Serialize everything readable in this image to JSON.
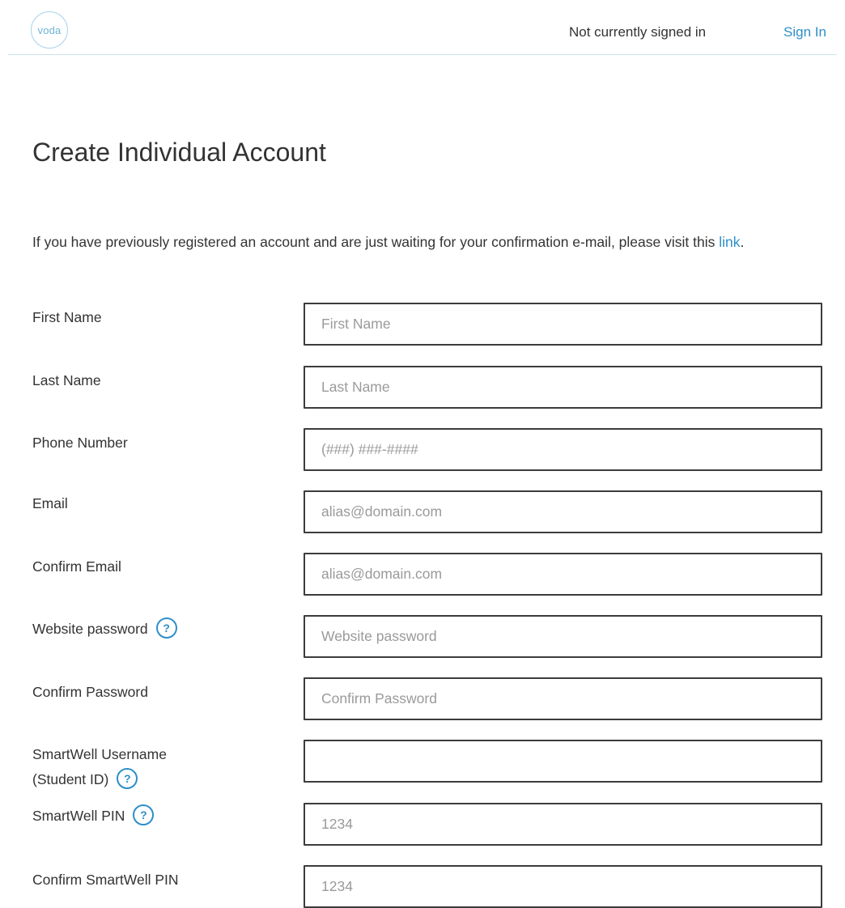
{
  "header": {
    "logo_text": "voda",
    "status_text": "Not currently signed in",
    "signin_label": "Sign In"
  },
  "page": {
    "title": "Create Individual Account",
    "intro_text": "If you have previously registered an account and are just waiting for your confirmation e-mail, please visit this ",
    "intro_link": "link",
    "intro_suffix": "."
  },
  "form": {
    "first_name": {
      "label": "First Name",
      "placeholder": "First Name",
      "value": ""
    },
    "last_name": {
      "label": "Last Name",
      "placeholder": "Last Name",
      "value": ""
    },
    "phone": {
      "label": "Phone Number",
      "placeholder": "(###) ###-####",
      "value": ""
    },
    "email": {
      "label": "Email",
      "placeholder": "alias@domain.com",
      "value": ""
    },
    "confirm_email": {
      "label": "Confirm Email",
      "placeholder": "alias@domain.com",
      "value": ""
    },
    "password": {
      "label": "Website password",
      "placeholder": "Website password",
      "value": ""
    },
    "confirm_password": {
      "label": "Confirm Password",
      "placeholder": "Confirm Password",
      "value": ""
    },
    "smartwell_username": {
      "label_line1": "SmartWell Username",
      "label_line2": "(Student ID)",
      "placeholder": "",
      "value": ""
    },
    "smartwell_pin": {
      "label": "SmartWell PIN",
      "placeholder": "1234",
      "value": ""
    },
    "confirm_smartwell_pin": {
      "label": "Confirm SmartWell PIN",
      "placeholder": "1234",
      "value": ""
    }
  },
  "icons": {
    "help_glyph": "?",
    "accent_color": "#2d8fc9",
    "help_icon_name": "help-circle-icon"
  }
}
